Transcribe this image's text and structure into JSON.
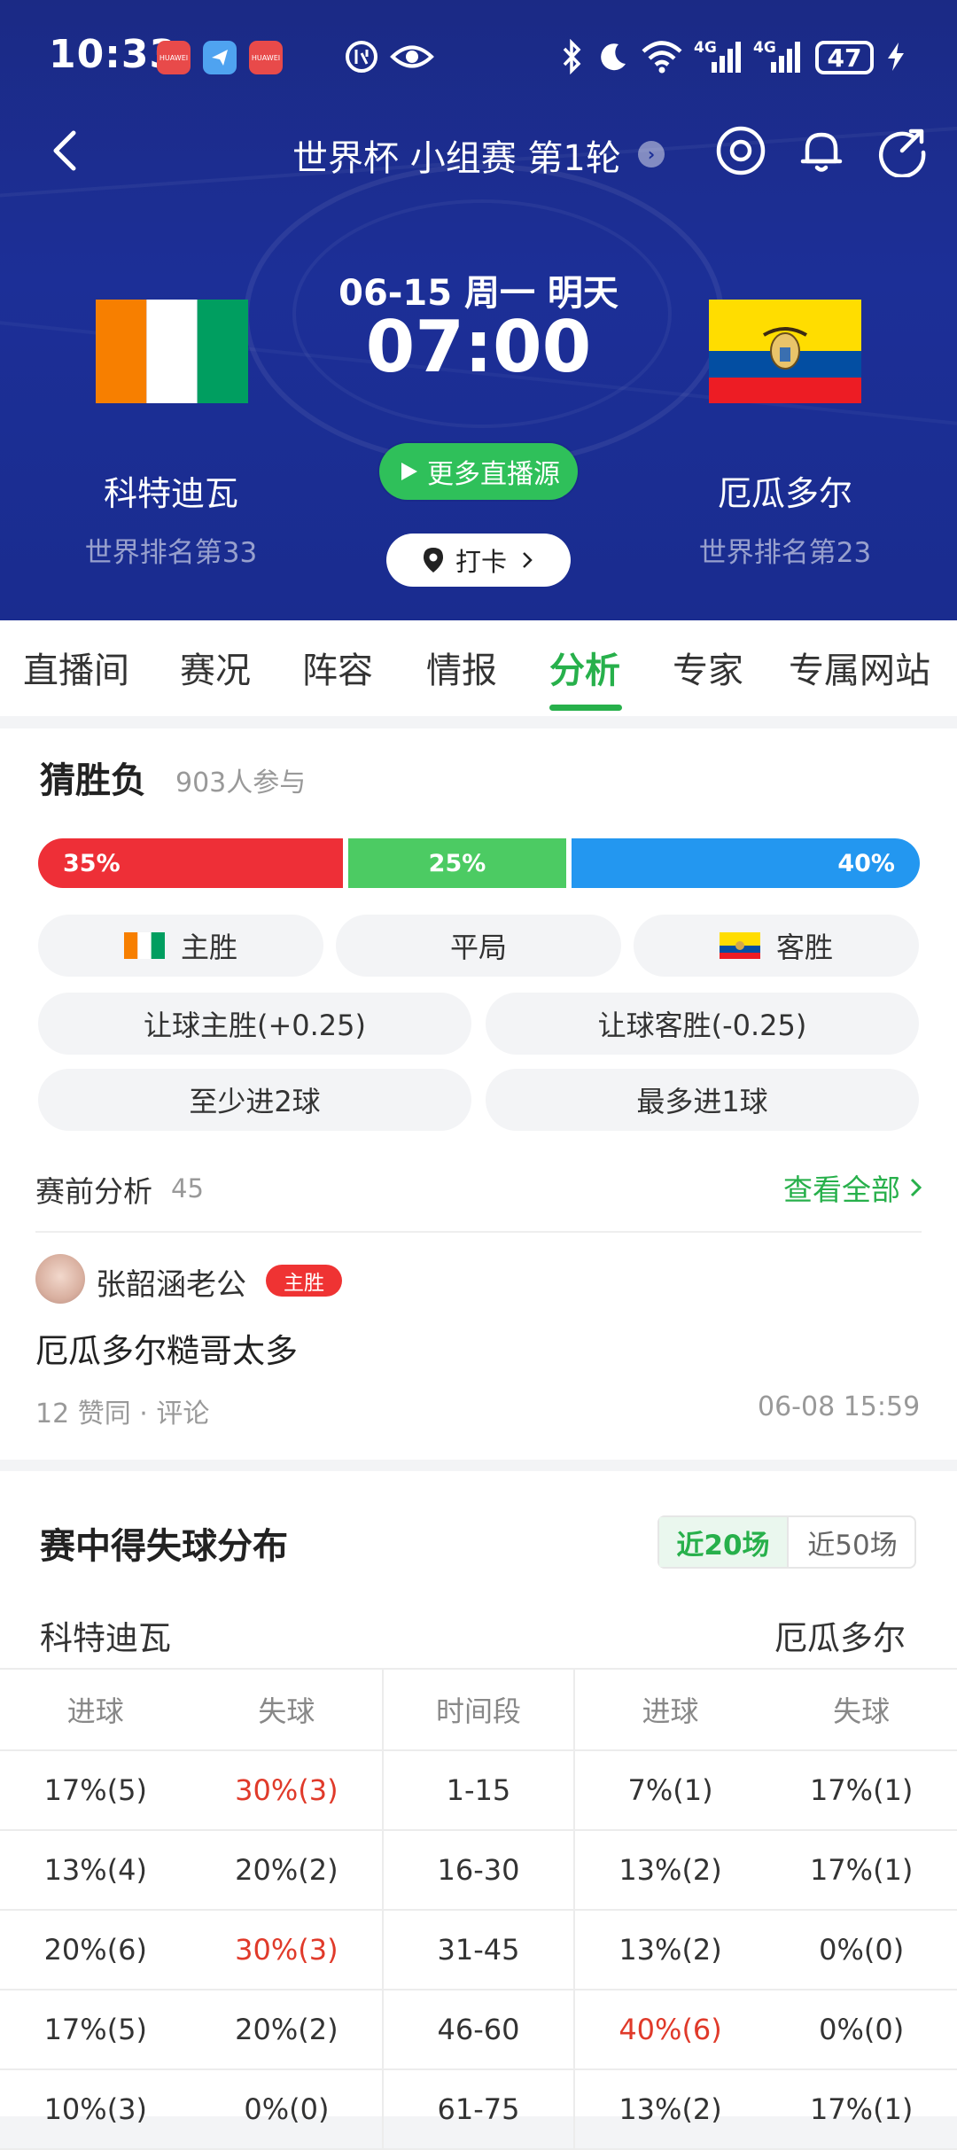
{
  "status_bar": {
    "time": "10:33",
    "battery": "47",
    "app_badges": [
      "HUAWEI",
      "HUAWEI"
    ],
    "network_labels": [
      "4G",
      "4G"
    ]
  },
  "nav": {
    "title": "世界杯 小组赛 第1轮"
  },
  "match": {
    "date": "06-15 周一 明天",
    "time": "07:00",
    "home": {
      "name": "科特迪瓦",
      "rank": "世界排名第33"
    },
    "away": {
      "name": "厄瓜多尔",
      "rank": "世界排名第23"
    },
    "live_button": "更多直播源",
    "checkin_button": "打卡"
  },
  "tabs": [
    "直播间",
    "赛况",
    "阵容",
    "情报",
    "分析",
    "专家",
    "专属网站"
  ],
  "active_tab": "分析",
  "prediction": {
    "title": "猜胜负",
    "participants": "903人参与",
    "bars": [
      {
        "label": "35%",
        "value": 35,
        "color": "#ee2f37"
      },
      {
        "label": "25%",
        "value": 25,
        "color": "#4ccb63"
      },
      {
        "label": "40%",
        "value": 40,
        "color": "#2397f0"
      }
    ],
    "options": {
      "home_win": "主胜",
      "draw": "平局",
      "away_win": "客胜",
      "handicap_home": "让球主胜(+0.25)",
      "handicap_away": "让球客胜(-0.25)",
      "at_least_2": "至少进2球",
      "at_most_1": "最多进1球"
    }
  },
  "pre_analysis": {
    "title": "赛前分析",
    "count": "45",
    "view_all": "查看全部",
    "post": {
      "user": "张韶涵老公",
      "tag": "主胜",
      "content": "厄瓜多尔糙哥太多",
      "stats": "12 赞同 · 评论",
      "timestamp": "06-08 15:59"
    }
  },
  "goal_distribution": {
    "title": "赛中得失球分布",
    "toggle": [
      "近20场",
      "近50场"
    ],
    "home_team": "科特迪瓦",
    "away_team": "厄瓜多尔",
    "headers": [
      "进球",
      "失球",
      "时间段",
      "进球",
      "失球"
    ],
    "rows": [
      {
        "cells": [
          "17%(5)",
          "30%(3)",
          "1-15",
          "7%(1)",
          "17%(1)"
        ],
        "highlight": [
          1
        ]
      },
      {
        "cells": [
          "13%(4)",
          "20%(2)",
          "16-30",
          "13%(2)",
          "17%(1)"
        ],
        "highlight": []
      },
      {
        "cells": [
          "20%(6)",
          "30%(3)",
          "31-45",
          "13%(2)",
          "0%(0)"
        ],
        "highlight": [
          1
        ]
      },
      {
        "cells": [
          "17%(5)",
          "20%(2)",
          "46-60",
          "40%(6)",
          "0%(0)"
        ],
        "highlight": [
          3
        ]
      },
      {
        "cells": [
          "10%(3)",
          "0%(0)",
          "61-75",
          "13%(2)",
          "17%(1)"
        ],
        "highlight": []
      }
    ]
  },
  "colors": {
    "header_blue": "#1c2f97",
    "accent_green": "#27b04b",
    "highlight_red": "#e03a2a"
  }
}
